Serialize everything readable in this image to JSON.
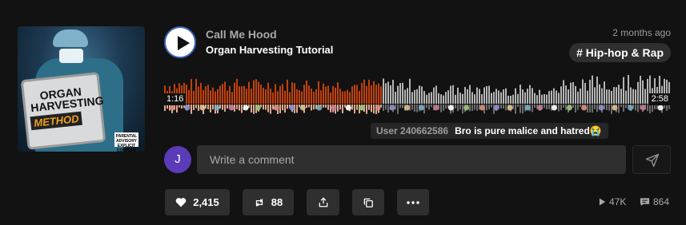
{
  "track": {
    "artist": "Call Me Hood",
    "title": "Organ Harvesting Tutorial",
    "posted": "2 months ago",
    "tag": "# Hip-hop & Rap",
    "artwork_text": "ORGAN HARVESTING",
    "artwork_method": "METHOD",
    "artwork_badge": "PARENTAL ADVISORY EXPLICIT CONTENT"
  },
  "player": {
    "elapsed": "1:16",
    "duration": "2:58",
    "progress": 0.427
  },
  "waveform_comment": {
    "user": "User 240662586",
    "text": "Bro is pure malice and hatred😭"
  },
  "composer": {
    "avatar_letter": "J",
    "placeholder": "Write a comment"
  },
  "actions": {
    "likes": "2,415",
    "reposts": "88"
  },
  "stats": {
    "plays": "47K",
    "comments": "864"
  },
  "colors": {
    "played": "#c2410c",
    "unplayed": "#b5b5b5",
    "accent_ring": "#3a66b8",
    "avatar": "#5b3bb8"
  }
}
